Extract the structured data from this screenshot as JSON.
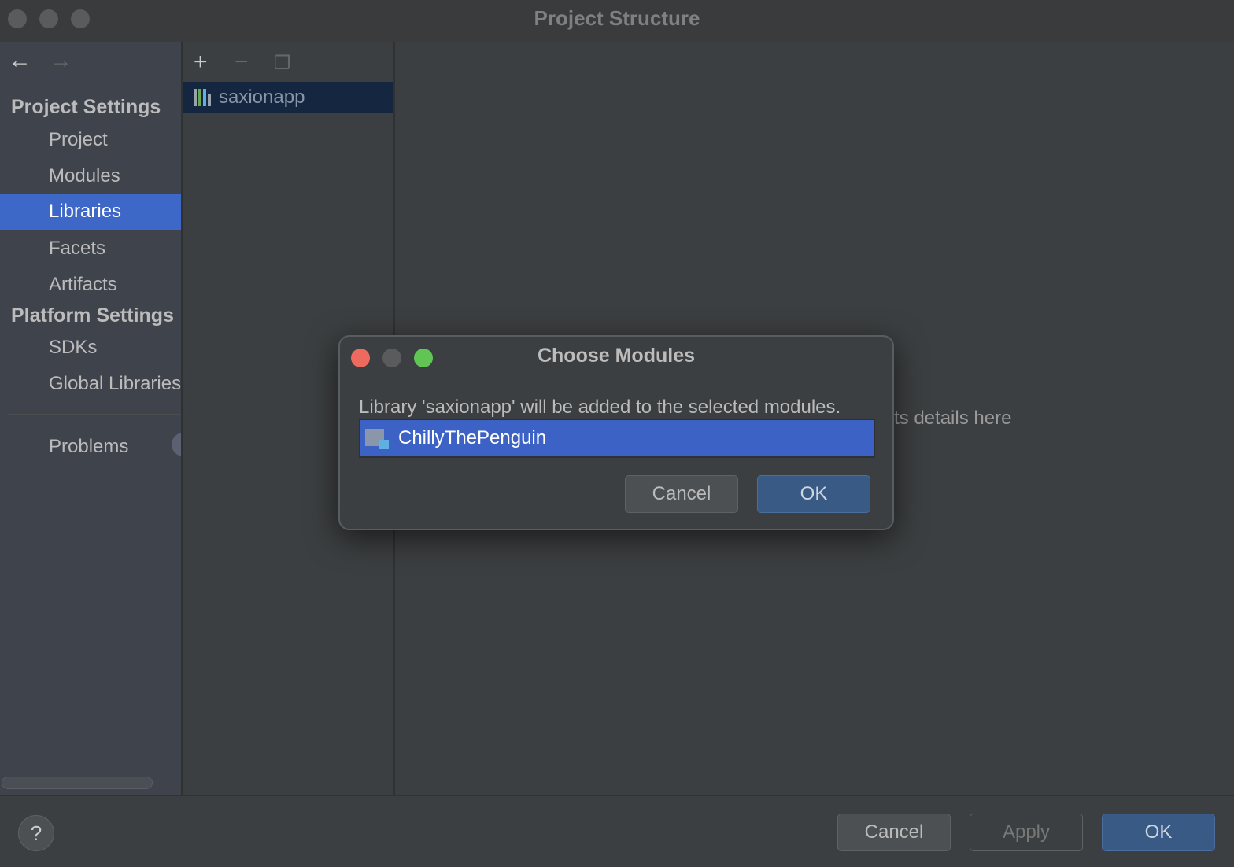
{
  "window": {
    "title": "Project Structure"
  },
  "nav": {
    "back_icon": "arrow-left-icon",
    "forward_icon": "arrow-right-icon"
  },
  "sidebar": {
    "project_settings": "Project Settings",
    "project_items": [
      {
        "label": "Project"
      },
      {
        "label": "Modules"
      },
      {
        "label": "Libraries",
        "selected": true
      },
      {
        "label": "Facets"
      },
      {
        "label": "Artifacts"
      }
    ],
    "platform_settings": "Platform Settings",
    "platform_items": [
      {
        "label": "SDKs"
      },
      {
        "label": "Global Libraries"
      }
    ],
    "problems": "Problems"
  },
  "libraries": {
    "toolbar": [
      "add-icon",
      "remove-icon",
      "copy-icon"
    ],
    "items": [
      {
        "label": "saxionapp"
      }
    ]
  },
  "main": {
    "hint": "ts details here"
  },
  "footer": {
    "help": "?",
    "cancel": "Cancel",
    "apply": "Apply",
    "ok": "OK"
  },
  "dialog": {
    "title": "Choose Modules",
    "message": "Library 'saxionapp' will be added to the selected modules.",
    "modules": [
      {
        "label": "ChillyThePenguin",
        "selected": true
      }
    ],
    "cancel": "Cancel",
    "ok": "OK"
  },
  "colors": {
    "selection": "#3d68c8",
    "close": "#ed6a5e",
    "zoom": "#61c554",
    "ok_button": "#385a85"
  }
}
